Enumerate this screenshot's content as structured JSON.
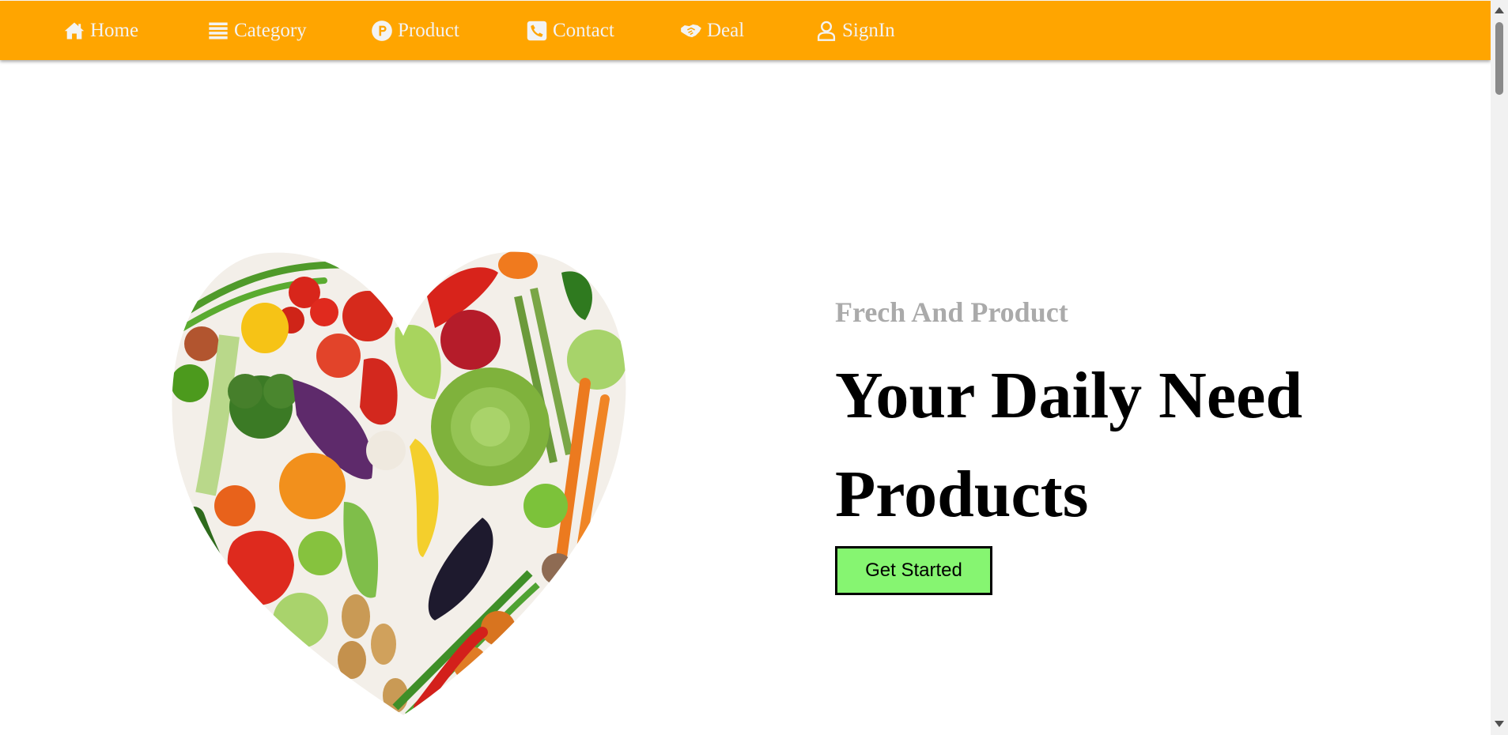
{
  "nav": {
    "items": [
      {
        "label": "Home",
        "icon": "home-icon"
      },
      {
        "label": "Category",
        "icon": "list-icon"
      },
      {
        "label": "Product",
        "icon": "product-p-icon"
      },
      {
        "label": "Contact",
        "icon": "phone-icon"
      },
      {
        "label": "Deal",
        "icon": "handshake-icon"
      },
      {
        "label": "SignIn",
        "icon": "user-icon"
      }
    ]
  },
  "hero": {
    "image": "heart-shaped-vegetables-image",
    "subtitle": "Frech And Product",
    "headline": "Your Daily Need Products",
    "cta_label": "Get Started"
  },
  "colors": {
    "navbar": "#ffa500",
    "nav_text": "#f3f3f3",
    "subtitle": "#aaaaaa",
    "cta_background": "#86f571"
  }
}
